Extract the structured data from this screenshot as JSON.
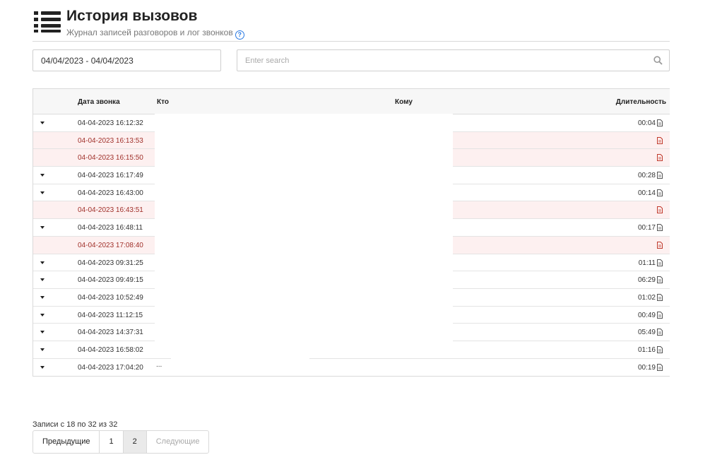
{
  "header": {
    "title": "История вызовов",
    "subtitle": "Журнал записей разговоров и лог звонков",
    "help_glyph": "?"
  },
  "filters": {
    "date_range": "04/04/2023 - 04/04/2023",
    "search_placeholder": "Enter search"
  },
  "table": {
    "columns": [
      "Дата звонка",
      "Кто",
      "Кому",
      "Длительность"
    ],
    "rows": [
      {
        "date": "04-04-2023 16:12:32",
        "duration": "00:04",
        "missed": false
      },
      {
        "date": "04-04-2023 16:13:53",
        "duration": "",
        "missed": true
      },
      {
        "date": "04-04-2023 16:15:50",
        "duration": "",
        "missed": true
      },
      {
        "date": "04-04-2023 16:17:49",
        "duration": "00:28",
        "missed": false
      },
      {
        "date": "04-04-2023 16:43:00",
        "duration": "00:14",
        "missed": false
      },
      {
        "date": "04-04-2023 16:43:51",
        "duration": "",
        "missed": true
      },
      {
        "date": "04-04-2023 16:48:11",
        "duration": "00:17",
        "missed": false
      },
      {
        "date": "04-04-2023 17:08:40",
        "duration": "",
        "missed": true
      },
      {
        "date": "04-04-2023 09:31:25",
        "duration": "01:11",
        "missed": false
      },
      {
        "date": "04-04-2023 09:49:15",
        "duration": "06:29",
        "missed": false
      },
      {
        "date": "04-04-2023 10:52:49",
        "duration": "01:02",
        "missed": false
      },
      {
        "date": "04-04-2023 11:12:15",
        "duration": "00:49",
        "missed": false
      },
      {
        "date": "04-04-2023 14:37:31",
        "duration": "05:49",
        "missed": false
      },
      {
        "date": "04-04-2023 16:58:02",
        "duration": "01:16",
        "missed": false
      },
      {
        "date": "04-04-2023 17:04:20",
        "duration": "00:19",
        "missed": false
      }
    ],
    "last_row_who": "..."
  },
  "pagination": {
    "records_text": "Записи с 18 по 32 из 32",
    "prev": "Предыдущие",
    "pages": [
      "1",
      "2"
    ],
    "next": "Следующие"
  },
  "icons": {
    "header": "list-icon",
    "search": "search-icon",
    "expand": "caret-down-icon",
    "recording": "document-icon"
  },
  "colors": {
    "missed_row_bg": "#fdf0f0",
    "missed_text": "#a0302a",
    "help_blue": "#2a7ae2"
  }
}
